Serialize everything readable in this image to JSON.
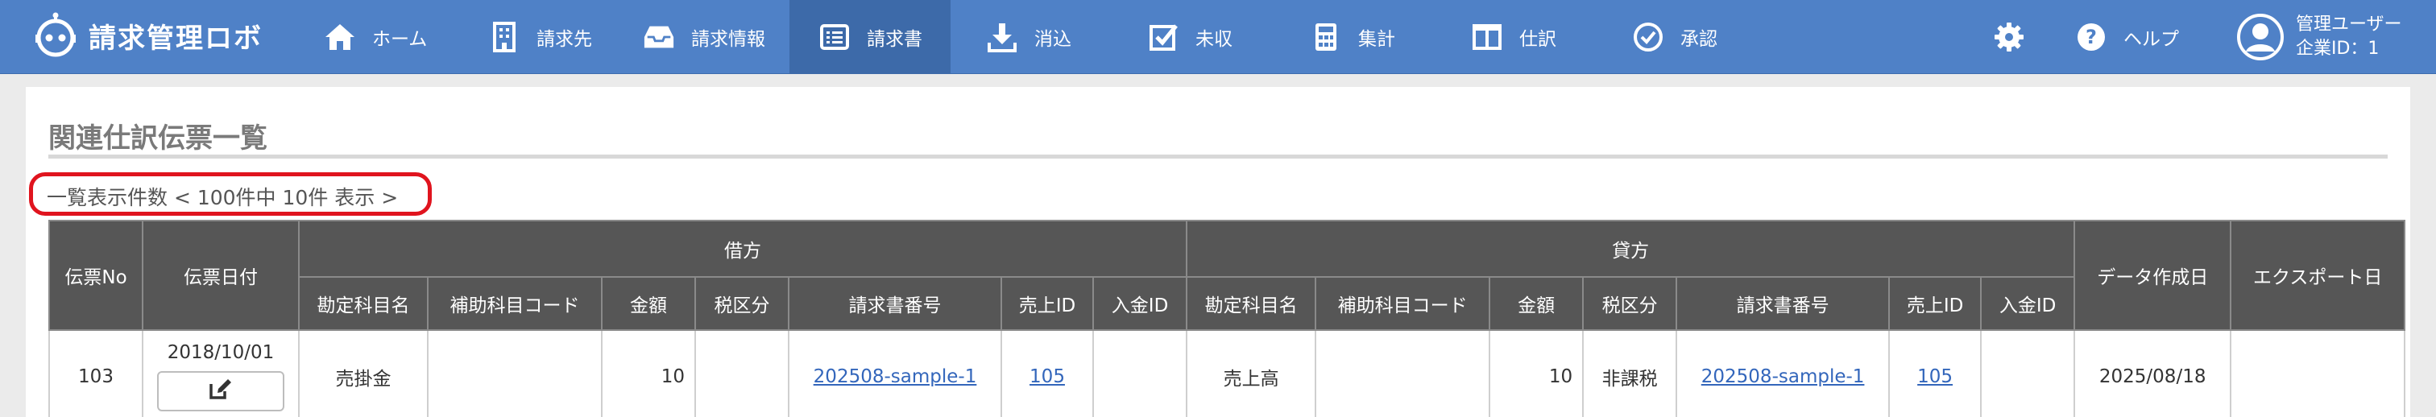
{
  "app": {
    "name": "請求管理ロボ"
  },
  "nav": {
    "items": [
      {
        "label": "ホーム",
        "icon": "home-icon"
      },
      {
        "label": "請求先",
        "icon": "building-icon"
      },
      {
        "label": "請求情報",
        "icon": "inbox-icon"
      },
      {
        "label": "請求書",
        "icon": "list-icon",
        "active": true
      },
      {
        "label": "消込",
        "icon": "download-icon"
      },
      {
        "label": "未収",
        "icon": "checkbox-icon"
      },
      {
        "label": "集計",
        "icon": "calculator-icon"
      },
      {
        "label": "仕訳",
        "icon": "columns-icon"
      },
      {
        "label": "承認",
        "icon": "check-circle-icon"
      }
    ],
    "settings_icon": "gear-icon",
    "help_label": "ヘルプ",
    "help_icon": "question-circle-icon"
  },
  "user": {
    "name": "管理ユーザー",
    "company": "企業ID：1",
    "icon": "user-circle-icon"
  },
  "page": {
    "title": "関連仕訳伝票一覧",
    "count_text": "一覧表示件数 < 100件中 10件 表示 >"
  },
  "table": {
    "headers": {
      "slip_no": "伝票No",
      "slip_date": "伝票日付",
      "debit": "借方",
      "credit": "貸方",
      "created": "データ作成日",
      "exported": "エクスポート日",
      "sub": [
        "勘定科目名",
        "補助科目コード",
        "金額",
        "税区分",
        "請求書番号",
        "売上ID",
        "入金ID"
      ]
    },
    "rows": [
      {
        "slip_no": "103",
        "slip_date": "2018/10/01",
        "edit_icon": "edit-icon",
        "debit": {
          "account": "売掛金",
          "sub_code": "",
          "amount": "10",
          "tax": "",
          "invoice_no": "202508-sample-1",
          "sales_id": "105",
          "payment_id": ""
        },
        "credit": {
          "account": "売上高",
          "sub_code": "",
          "amount": "10",
          "tax": "非課税",
          "invoice_no": "202508-sample-1",
          "sales_id": "105",
          "payment_id": ""
        },
        "created": "2025/08/18",
        "exported": ""
      }
    ]
  },
  "colors": {
    "header_bg": "#4f81c7",
    "header_active": "#3d6aa9",
    "table_header": "#565656",
    "highlight": "#e0141e",
    "link": "#3366bb"
  }
}
